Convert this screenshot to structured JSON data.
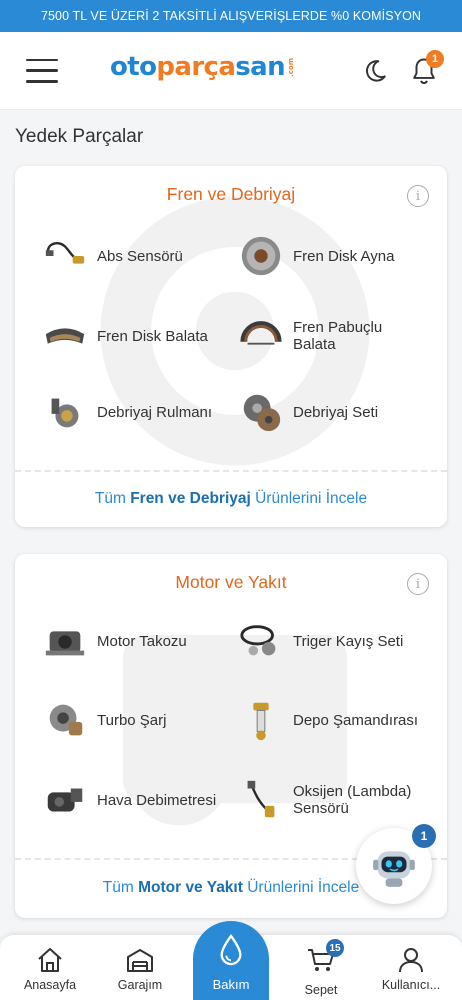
{
  "promo": {
    "text": "7500 TL VE ÜZERİ 2 TAKSİTLİ ALIŞVERİŞLERDE %0 KOMİSYON"
  },
  "header": {
    "logo": {
      "part1": "oto",
      "part2": "parça",
      "part3": "san",
      "suffix": ".com"
    },
    "notification_count": "1"
  },
  "page": {
    "title": "Yedek Parçalar"
  },
  "categories": [
    {
      "title": "Fren ve Debriyaj",
      "items": [
        {
          "label": "Abs Sensörü",
          "icon": "abs-sensor-icon"
        },
        {
          "label": "Fren Disk Ayna",
          "icon": "brake-disc-icon"
        },
        {
          "label": "Fren Disk Balata",
          "icon": "brake-pad-icon"
        },
        {
          "label": "Fren Pabuçlu Balata",
          "icon": "brake-shoe-icon"
        },
        {
          "label": "Debriyaj Rulmanı",
          "icon": "clutch-bearing-icon"
        },
        {
          "label": "Debriyaj Seti",
          "icon": "clutch-kit-icon"
        }
      ],
      "footer": {
        "prefix": "Tüm ",
        "name": "Fren ve Debriyaj",
        "suffix": " Ürünlerini İncele"
      }
    },
    {
      "title": "Motor ve Yakıt",
      "items": [
        {
          "label": "Motor Takozu",
          "icon": "engine-mount-icon"
        },
        {
          "label": "Triger Kayış Seti",
          "icon": "timing-belt-icon"
        },
        {
          "label": "Turbo Şarj",
          "icon": "turbo-icon"
        },
        {
          "label": "Depo Şamandırası",
          "icon": "fuel-sender-icon"
        },
        {
          "label": "Hava Debimetresi",
          "icon": "air-flow-meter-icon"
        },
        {
          "label": "Oksijen (Lambda) Sensörü",
          "icon": "oxygen-sensor-icon"
        }
      ],
      "footer": {
        "prefix": "Tüm ",
        "name": "Motor ve Yakıt",
        "suffix": " Ürünlerini İncele"
      }
    }
  ],
  "chat": {
    "badge": "1"
  },
  "bottom_nav": {
    "home": "Anasayfa",
    "garage": "Garajım",
    "care": "Bakım",
    "cart": "Sepet",
    "cart_count": "15",
    "user": "Kullanıcı..."
  },
  "colors": {
    "primary": "#2a8ad6",
    "accent": "#e2661c"
  }
}
